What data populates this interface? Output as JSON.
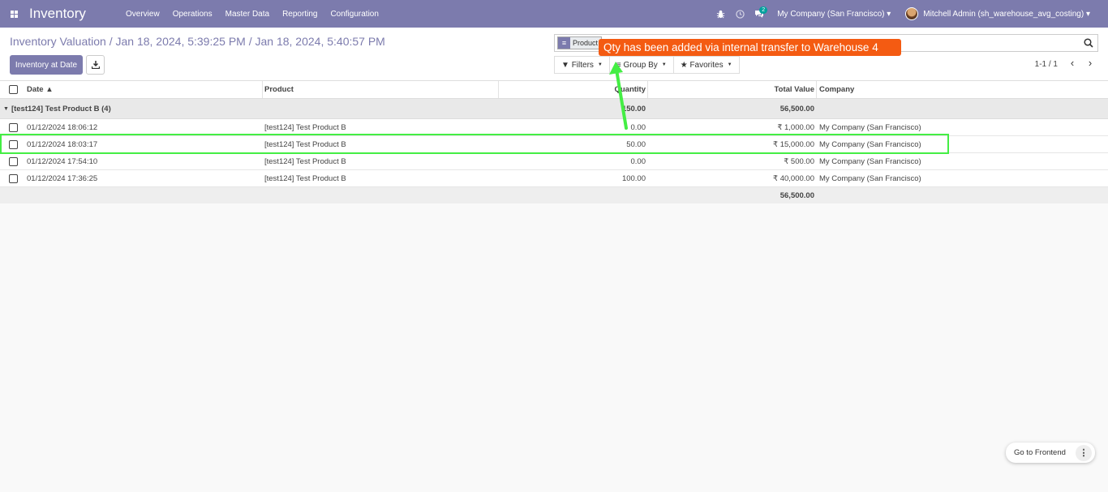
{
  "navbar": {
    "app_name": "Inventory",
    "menu": [
      "Overview",
      "Operations",
      "Master Data",
      "Reporting",
      "Configuration"
    ],
    "chat_count": "2",
    "company": "My Company (San Francisco)",
    "user": "Mitchell Admin (sh_warehouse_avg_costing)"
  },
  "control": {
    "breadcrumb": "Inventory Valuation / Jan 18, 2024, 5:39:25 PM / Jan 18, 2024, 5:40:57 PM",
    "btn_at_date": "Inventory at Date",
    "search_facet": "Product",
    "filters": "Filters",
    "group_by": "Group By",
    "favorites": "Favorites",
    "pager": "1-1 / 1"
  },
  "annotation": {
    "text": "Qty has been added via internal transfer to Warehouse 4",
    "highlight_color": "#44ee44",
    "callout_color": "#f45b12"
  },
  "table": {
    "headers": {
      "date": "Date",
      "product": "Product",
      "quantity": "Quantity",
      "value": "Total Value",
      "company": "Company"
    },
    "group": {
      "label": "[test124] Test Product B (4)",
      "quantity": "150.00",
      "value": "56,500.00"
    },
    "rows": [
      {
        "date": "01/12/2024 18:06:12",
        "product": "[test124] Test Product B",
        "quantity": "0.00",
        "value": "₹ 1,000.00",
        "company": "My Company (San Francisco)"
      },
      {
        "date": "01/12/2024 18:03:17",
        "product": "[test124] Test Product B",
        "quantity": "50.00",
        "value": "₹ 15,000.00",
        "company": "My Company (San Francisco)"
      },
      {
        "date": "01/12/2024 17:54:10",
        "product": "[test124] Test Product B",
        "quantity": "0.00",
        "value": "₹ 500.00",
        "company": "My Company (San Francisco)"
      },
      {
        "date": "01/12/2024 17:36:25",
        "product": "[test124] Test Product B",
        "quantity": "100.00",
        "value": "₹ 40,000.00",
        "company": "My Company (San Francisco)"
      }
    ],
    "footer_value": "56,500.00"
  },
  "frontend_button": "Go to Frontend",
  "colors": {
    "primary": "#7c7bad",
    "group_bg": "#e9e9e9"
  }
}
